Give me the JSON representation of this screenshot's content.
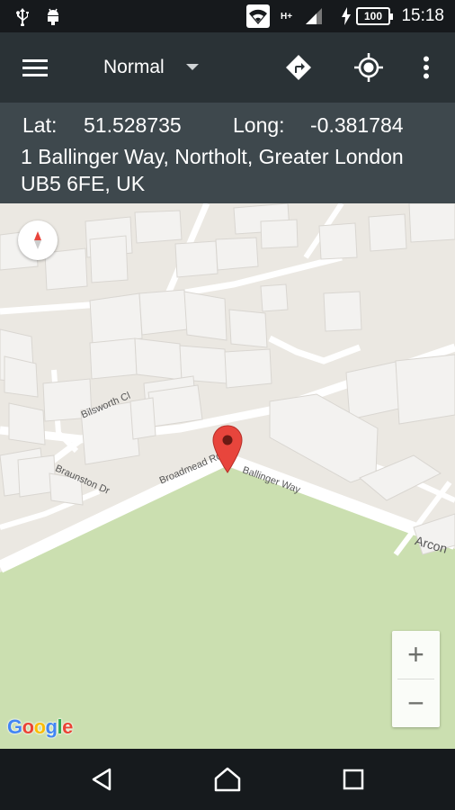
{
  "status_bar": {
    "time": "15:18",
    "battery": "100",
    "network": "H+",
    "icons": [
      "usb-icon",
      "android-debug-icon",
      "wifi-icon",
      "signal-icon",
      "charging-icon"
    ]
  },
  "toolbar": {
    "menu_icon": "hamburger-menu-icon",
    "map_type": "Normal",
    "directions_icon": "directions-icon",
    "location_icon": "my-location-icon",
    "more_icon": "more-vert-icon"
  },
  "info": {
    "lat_label": "Lat:",
    "lat_value": "51.528735",
    "long_label": "Long:",
    "long_value": "-0.381784",
    "address": "1 Ballinger Way, Northolt, Greater London UB5 6FE, UK"
  },
  "map": {
    "streets": [
      "Bilsworth Cl",
      "Braunston Dr",
      "Broadmead Rd",
      "Ballinger Way",
      "Arcon"
    ],
    "attribution": "Google",
    "zoom_in": "+",
    "zoom_out": "−",
    "marker_icon": "map-marker-icon",
    "compass_icon": "compass-icon",
    "colors": {
      "land": "#ebe8e2",
      "park": "#cbdfb0",
      "building": "#f3f2f0",
      "road": "#ffffff",
      "marker": "#e8453c"
    }
  },
  "nav_bar": {
    "back_icon": "back-icon",
    "home_icon": "home-icon",
    "recents_icon": "recents-icon"
  }
}
